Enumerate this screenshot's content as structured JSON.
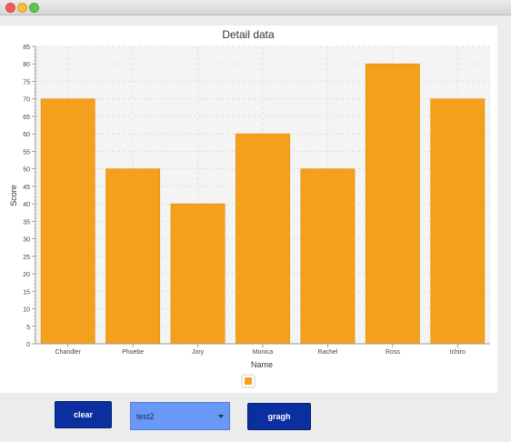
{
  "controls": {
    "clear_label": "clear",
    "select_value": "test2",
    "gragh_label": "gragh"
  },
  "colors": {
    "bar": "#f5a01c",
    "button": "#0b2f9f",
    "select": "#6a98f7"
  },
  "chart_data": {
    "type": "bar",
    "title": "Detail data",
    "xlabel": "Name",
    "ylabel": "Score",
    "categories": [
      "Chandler",
      "Phoebe",
      "Jory",
      "Monica",
      "Rachel",
      "Ross",
      "Ichiro"
    ],
    "series": [
      {
        "values": [
          70,
          50,
          40,
          60,
          50,
          80,
          70
        ]
      }
    ],
    "ylim": [
      0,
      85
    ],
    "yticks": [
      0,
      5,
      10,
      15,
      20,
      25,
      30,
      35,
      40,
      45,
      50,
      55,
      60,
      65,
      70,
      75,
      80,
      85
    ],
    "grid": true,
    "legend": "bottom-center"
  }
}
